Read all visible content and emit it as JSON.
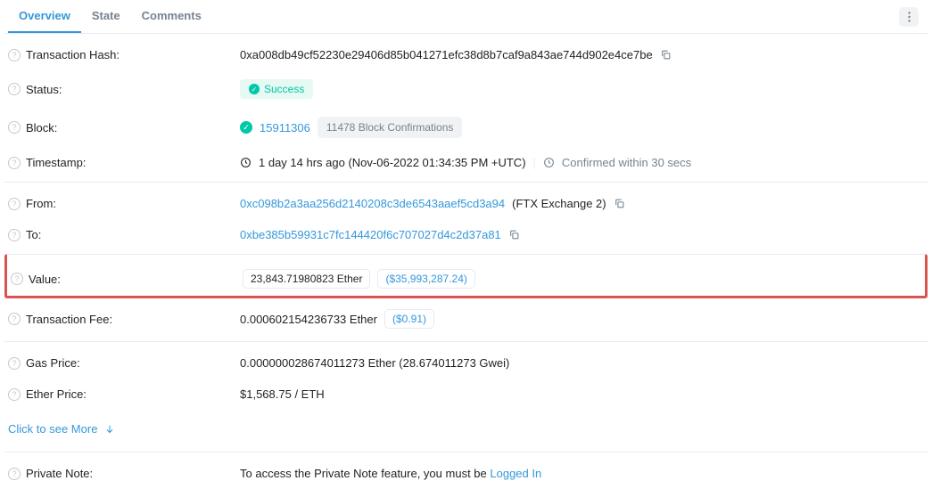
{
  "tabs": {
    "overview": "Overview",
    "state": "State",
    "comments": "Comments"
  },
  "labels": {
    "txhash": "Transaction Hash:",
    "status": "Status:",
    "block": "Block:",
    "timestamp": "Timestamp:",
    "from": "From:",
    "to": "To:",
    "value": "Value:",
    "txfee": "Transaction Fee:",
    "gasprice": "Gas Price:",
    "etherprice": "Ether Price:",
    "privatenote": "Private Note:"
  },
  "txhash": "0xa008db49cf52230e29406d85b041271efc38d8b7caf9a843ae744d902e4ce7be",
  "status_text": "Success",
  "block_number": "15911306",
  "block_conf": "11478 Block Confirmations",
  "timestamp_ago": "1 day 14 hrs ago (Nov-06-2022 01:34:35 PM +UTC)",
  "timestamp_conf": "Confirmed within 30 secs",
  "from_addr": "0xc098b2a3aa256d2140208c3de6543aaef5cd3a94",
  "from_name": "(FTX Exchange 2)",
  "to_addr": "0xbe385b59931c7fc144420f6c707027d4c2d37a81",
  "value_eth": "23,843.71980823 Ether",
  "value_usd": "($35,993,287.24)",
  "txfee_eth": "0.000602154236733 Ether",
  "txfee_usd": "($0.91)",
  "gasprice": "0.000000028674011273 Ether (28.674011273 Gwei)",
  "etherprice": "$1,568.75 / ETH",
  "more_link": "Click to see More",
  "privatenote_prefix": "To access the Private Note feature, you must be ",
  "privatenote_link": "Logged In"
}
